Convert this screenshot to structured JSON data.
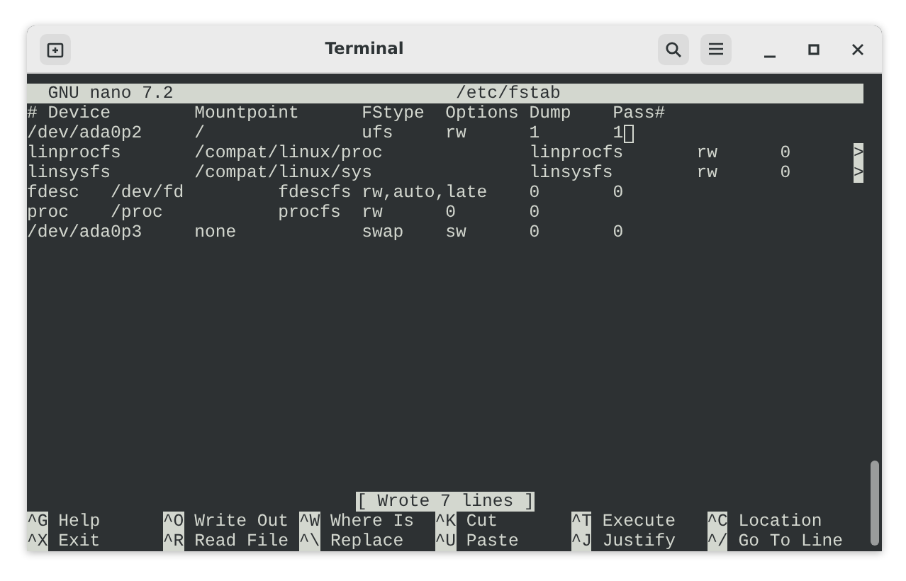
{
  "window": {
    "title": "Terminal"
  },
  "editor": {
    "name": "GNU nano 7.2",
    "filename": "/etc/fstab"
  },
  "lines": [
    {
      "text": "# Device        Mountpoint      FStype  Options Dump    Pass#",
      "cursor": false
    },
    {
      "text": "/dev/ada0p2     /               ufs     rw      1       1",
      "cursor": true
    },
    {
      "text": "linprocfs       /compat/linux/proc              linprocfs       rw      0",
      "cursor": false,
      "overflow_mark": ">"
    },
    {
      "text": "linsysfs        /compat/linux/sys               linsysfs        rw      0",
      "cursor": false,
      "overflow_mark": ">"
    },
    {
      "text": "fdesc   /dev/fd         fdescfs rw,auto,late    0       0",
      "cursor": false
    },
    {
      "text": "proc    /proc           procfs  rw      0       0",
      "cursor": false
    },
    {
      "text": "/dev/ada0p3     none            swap    sw      0       0",
      "cursor": false
    }
  ],
  "status": "[ Wrote 7 lines ]",
  "shortcuts": [
    [
      {
        "key": "^G",
        "label": "Help"
      },
      {
        "key": "^O",
        "label": "Write Out"
      },
      {
        "key": "^W",
        "label": "Where Is"
      },
      {
        "key": "^K",
        "label": "Cut"
      },
      {
        "key": "^T",
        "label": "Execute"
      },
      {
        "key": "^C",
        "label": "Location"
      }
    ],
    [
      {
        "key": "^X",
        "label": "Exit"
      },
      {
        "key": "^R",
        "label": "Read File"
      },
      {
        "key": "^\\",
        "label": "Replace"
      },
      {
        "key": "^U",
        "label": "Paste"
      },
      {
        "key": "^J",
        "label": "Justify"
      },
      {
        "key": "^/",
        "label": "Go To Line"
      }
    ]
  ]
}
